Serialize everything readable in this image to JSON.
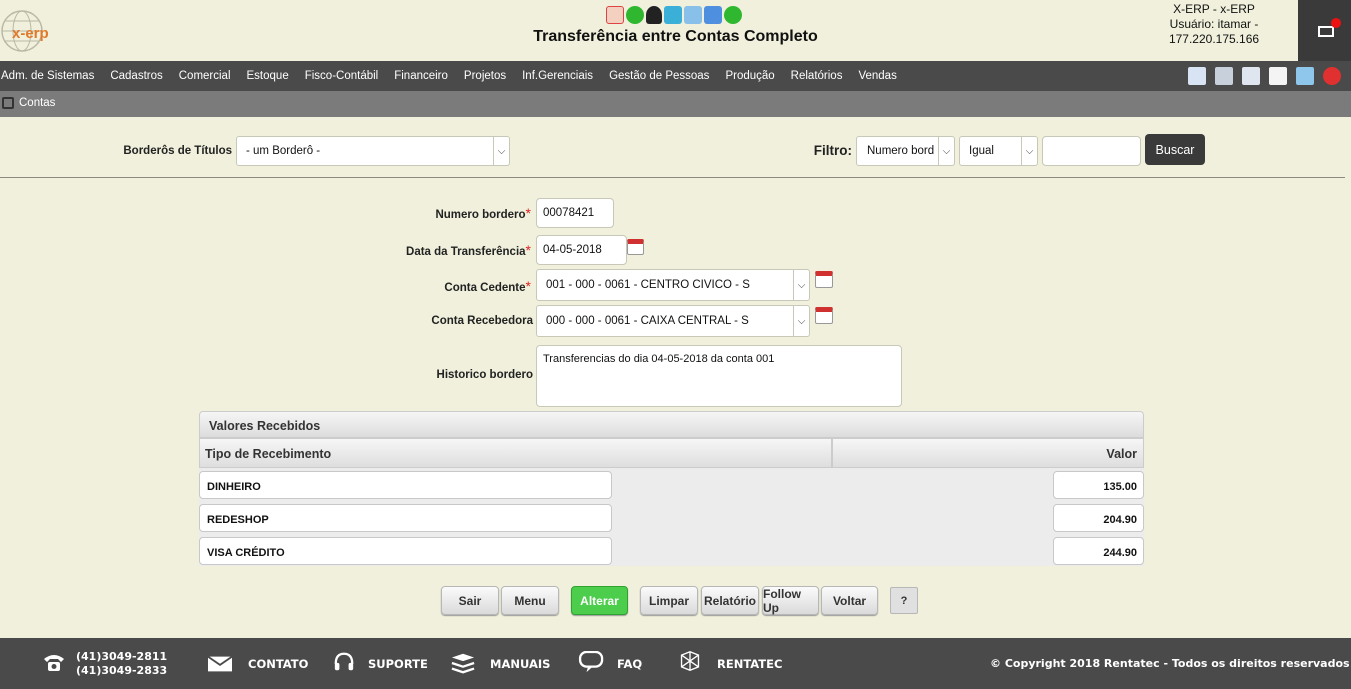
{
  "header": {
    "logo_text": "x-erp",
    "title": "Transferência entre Contas Completo",
    "user_line1": "X-ERP - x-ERP",
    "user_line2": "Usuário: itamar -",
    "user_line3": "177.220.175.166"
  },
  "menu": [
    "Adm. de Sistemas",
    "Cadastros",
    "Comercial",
    "Estoque",
    "Fisco-Contábil",
    "Financeiro",
    "Projetos",
    "Inf.Gerenciais",
    "Gestão de Pessoas",
    "Produção",
    "Relatórios",
    "Vendas"
  ],
  "breadcrumb": "Contas",
  "filter": {
    "bordero_label": "Borderôs de Títulos",
    "bordero_value": "- um Borderô -",
    "filtro_label": "Filtro:",
    "field_value": "Numero bord",
    "op_value": "Igual",
    "search_value": "",
    "buscar_label": "Buscar"
  },
  "form": {
    "numero_label": "Numero bordero",
    "numero_value": "00078421",
    "data_label": "Data da Transferência",
    "data_value": "04-05-2018",
    "cedente_label": "Conta Cedente",
    "cedente_value": "001 - 000 - 0061 - CENTRO CIVICO - S",
    "recebedora_label": "Conta Recebedora",
    "recebedora_value": "000 - 000 - 0061 - CAIXA CENTRAL - S",
    "historico_label": "Historico bordero",
    "historico_value": "Transferencias do dia 04-05-2018 da conta 001",
    "required_mark": "*"
  },
  "table": {
    "title": "Valores Recebidos",
    "col_tipo": "Tipo de Recebimento",
    "col_valor": "Valor",
    "rows": [
      {
        "tipo": "DINHEIRO",
        "valor": "135.00"
      },
      {
        "tipo": "REDESHOP",
        "valor": "204.90"
      },
      {
        "tipo": "VISA CRÉDITO",
        "valor": "244.90"
      }
    ]
  },
  "buttons": {
    "sair": "Sair",
    "menu": "Menu",
    "alterar": "Alterar",
    "limpar": "Limpar",
    "relatorio": "Relatório",
    "followup": "Follow Up",
    "voltar": "Voltar",
    "help": "?"
  },
  "footer": {
    "phone1": "(41)3049-2811",
    "phone2": "(41)3049-2833",
    "contato": "CONTATO",
    "suporte": "SUPORTE",
    "manuais": "MANUAIS",
    "faq": "FAQ",
    "rentatec": "RENTATEC",
    "copyright": "© Copyright 2018 Rentatec - Todos os direitos reservados"
  },
  "colors": {
    "background": "#f0f0dc",
    "menubar": "#4a4a4a",
    "accent_green": "#4ccd4c"
  }
}
